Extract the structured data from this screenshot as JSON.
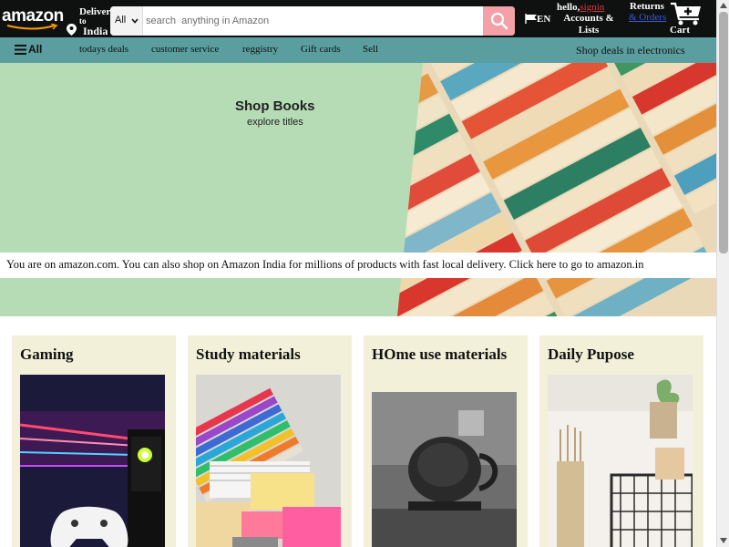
{
  "navbar": {
    "logo": "amazon",
    "deliver_line1": "Deliver",
    "deliver_line2": "to",
    "deliver_country": "India",
    "search_category": "All",
    "search_placeholder": "search  anything in Amazon",
    "lang": "EN",
    "hello_prefix": "hello,",
    "hello_name": "signin",
    "accounts": "Accounts & Lists",
    "returns": "Returns",
    "orders": "& Orders",
    "cart": "Cart"
  },
  "subnav": {
    "all": "All",
    "items": [
      "todays deals",
      "customer service",
      "reggistry",
      "Gift cards",
      "Sell"
    ],
    "shop_deals": "Shop deals in electronics"
  },
  "hero": {
    "title": "Shop Books",
    "subtitle": "explore titles",
    "notice": "You are on amazon.com. You can also shop on Amazon India for millions of products with fast local delivery. Click here to go to amazon.in"
  },
  "cards": [
    {
      "title": "Gaming"
    },
    {
      "title": "Study materials"
    },
    {
      "title": "HOme use materials"
    },
    {
      "title": "Daily Pupose"
    }
  ],
  "colors": {
    "navbar_bg": "#0f1111",
    "subnav_bg": "#5b9ea0",
    "hero_bg": "#b6dcb6",
    "card_bg": "#f2f0d8",
    "search_btn": "#f3a0a8"
  },
  "icons": [
    "location-pin-icon",
    "chevron-down-icon",
    "search-icon",
    "flag-icon",
    "cart-icon",
    "menu-icon"
  ]
}
